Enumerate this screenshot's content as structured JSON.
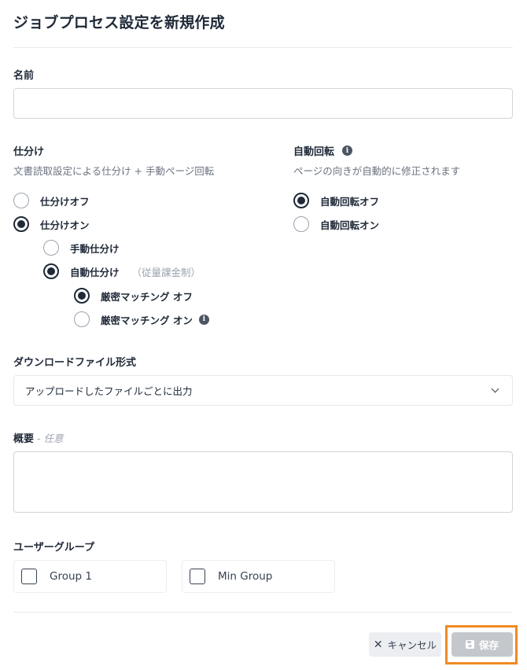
{
  "page": {
    "title": "ジョブプロセス設定を新規作成"
  },
  "name_field": {
    "label": "名前",
    "value": "",
    "placeholder": ""
  },
  "sorting": {
    "label": "仕分け",
    "description": "文書読取設定による仕分け + 手動ページ回転",
    "options": [
      {
        "label": "仕分けオフ",
        "checked": false
      },
      {
        "label": "仕分けオン",
        "checked": true
      }
    ],
    "sub_options": [
      {
        "label": "手動仕分け",
        "checked": false
      },
      {
        "label": "自動仕分け",
        "note": "（従量課金制）",
        "checked": true
      }
    ],
    "matching_options": [
      {
        "label": "厳密マッチング オフ",
        "checked": true
      },
      {
        "label": "厳密マッチング オン",
        "checked": false,
        "icon": "info-icon"
      }
    ]
  },
  "rotation": {
    "label": "自動回転",
    "icon": "info-icon",
    "description": "ページの向きが自動的に修正されます",
    "options": [
      {
        "label": "自動回転オフ",
        "checked": true
      },
      {
        "label": "自動回転オン",
        "checked": false
      }
    ]
  },
  "download_format": {
    "label": "ダウンロードファイル形式",
    "selected": "アップロードしたファイルごとに出力"
  },
  "summary": {
    "label": "概要",
    "optional": " - 任意",
    "value": ""
  },
  "user_groups": {
    "label": "ユーザーグループ",
    "groups": [
      {
        "label": "Group 1",
        "checked": false
      },
      {
        "label": "Min Group",
        "checked": false
      }
    ]
  },
  "footer": {
    "cancel_label": "キャンセル",
    "cancel_icon": "x-icon",
    "save_label": "保存",
    "save_icon": "floppy-disk-icon"
  },
  "colors": {
    "text": "#1f2937",
    "muted": "#6b7280",
    "save_disabled": "#c4c8cd",
    "highlight": "#f08a24"
  }
}
